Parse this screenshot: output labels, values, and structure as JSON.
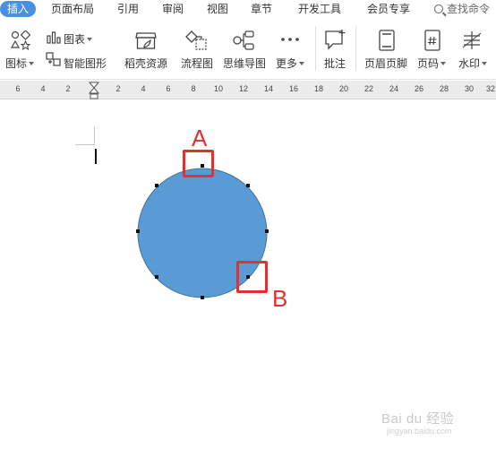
{
  "tabs": [
    {
      "label": "插入",
      "active": true
    },
    {
      "label": "页面布局"
    },
    {
      "label": "引用"
    },
    {
      "label": "审阅"
    },
    {
      "label": "视图"
    },
    {
      "label": "章节"
    },
    {
      "label": "开发工具"
    },
    {
      "label": "会员专享"
    }
  ],
  "search": {
    "label": "查找命令"
  },
  "ribbon": {
    "icon_label": "图标",
    "chart_label": "图表",
    "smart_art_label": "智能图形",
    "daoke_label": "稻壳资源",
    "flowchart_label": "流程图",
    "mindmap_label": "思维导图",
    "more_label": "更多",
    "comment_label": "批注",
    "header_footer_label": "页眉页脚",
    "page_number_label": "页码",
    "watermark_label": "水印"
  },
  "ruler": {
    "labels": [
      "6",
      "4",
      "2",
      "2",
      "4",
      "6",
      "8",
      "10",
      "12",
      "14",
      "16",
      "18",
      "20",
      "22",
      "24",
      "26",
      "28",
      "30",
      "32"
    ]
  },
  "document": {
    "shape_color": "#5b9bd5",
    "marker_a": "A",
    "marker_b": "B",
    "marker_color": "#e33030"
  },
  "watermark": {
    "text": "Bai du 经验",
    "sub": "jingyan.baidu.com"
  }
}
